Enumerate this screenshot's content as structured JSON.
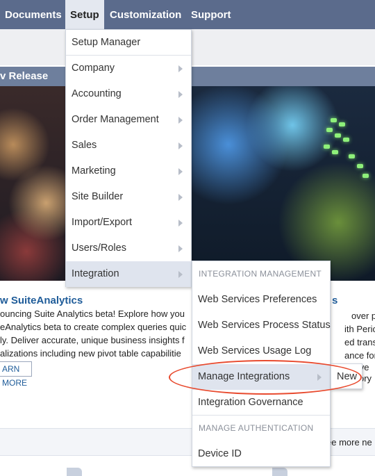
{
  "topnav": {
    "items": [
      "Documents",
      "Setup",
      "Customization",
      "Support"
    ]
  },
  "portlet": {
    "title": "v Release"
  },
  "article": {
    "title": "w SuiteAnalytics",
    "lines": [
      "ouncing Suite Analytics beta! Explore how you",
      "eAnalytics beta to create complex queries quic",
      "ly. Deliver accurate, unique business insights f",
      "alizations including new pivot table capabilitie"
    ],
    "learn_more": "ARN MORE"
  },
  "right_article": {
    "title": "s",
    "lines": [
      "over perio",
      "ith Period I",
      "ed transact",
      "ance for sta",
      "ative",
      "ory"
    ]
  },
  "footer": {
    "see_more": "ee more ne"
  },
  "setup_menu": {
    "items": [
      {
        "label": "Setup Manager",
        "submenu": false
      },
      {
        "label": "Company",
        "submenu": true
      },
      {
        "label": "Accounting",
        "submenu": true
      },
      {
        "label": "Order Management",
        "submenu": true
      },
      {
        "label": "Sales",
        "submenu": true
      },
      {
        "label": "Marketing",
        "submenu": true
      },
      {
        "label": "Site Builder",
        "submenu": true
      },
      {
        "label": "Import/Export",
        "submenu": true
      },
      {
        "label": "Users/Roles",
        "submenu": true
      },
      {
        "label": "Integration",
        "submenu": true
      }
    ]
  },
  "integration_menu": {
    "section1": "INTEGRATION MANAGEMENT",
    "items1": [
      "Web Services Preferences",
      "Web Services Process Status",
      "Web Services Usage Log",
      "Manage Integrations",
      "Integration Governance"
    ],
    "section2": "MANAGE AUTHENTICATION",
    "items2": [
      "Device ID"
    ]
  },
  "manage_integrations_menu": {
    "items": [
      "New"
    ]
  },
  "colors": {
    "nav_bg": "#5b6b8c",
    "link": "#1f5c99",
    "highlight_ellipse": "#e84a2e",
    "menu_active_bg": "#dfe4ee"
  }
}
